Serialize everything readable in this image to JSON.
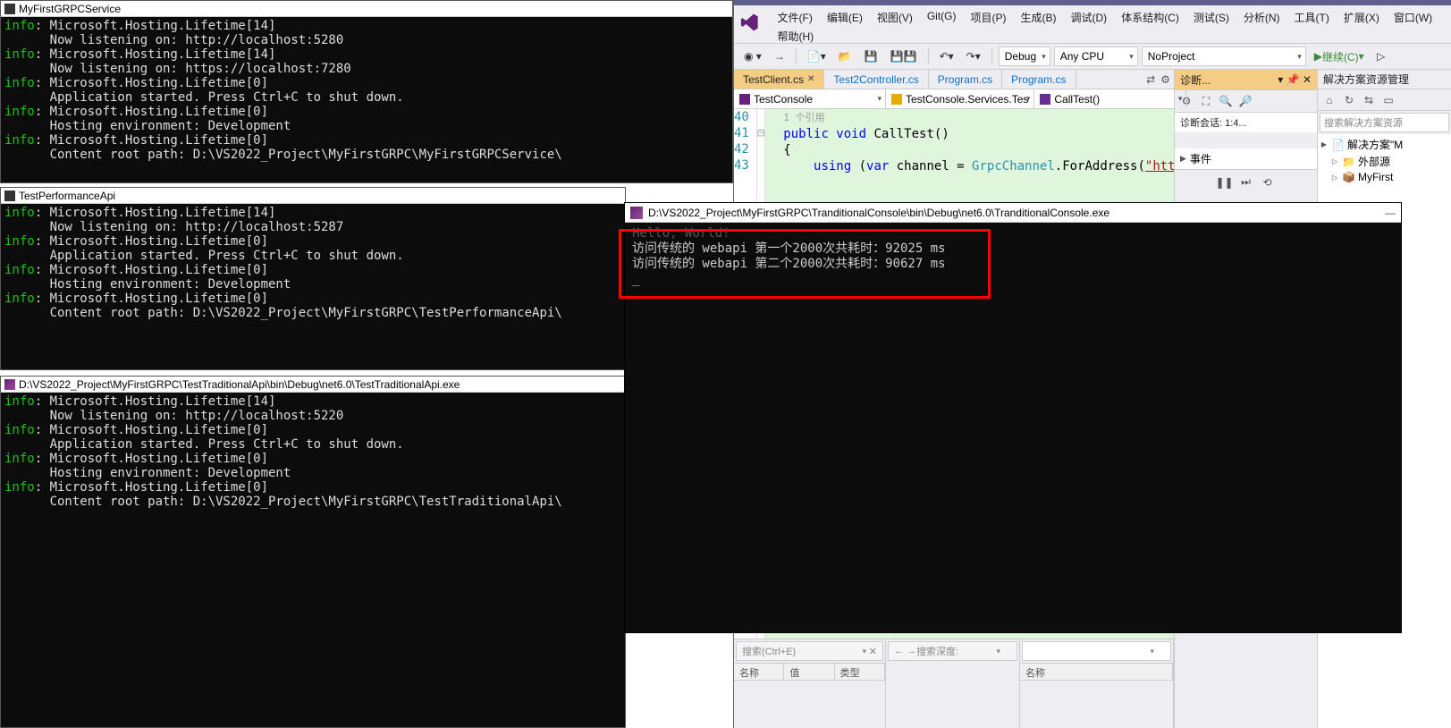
{
  "terminals": {
    "t1": {
      "title": "MyFirstGRPCService",
      "lines": [
        {
          "p": "info",
          "t": ": Microsoft.Hosting.Lifetime[14]"
        },
        {
          "p": "",
          "t": "      Now listening on: http://localhost:5280"
        },
        {
          "p": "info",
          "t": ": Microsoft.Hosting.Lifetime[14]"
        },
        {
          "p": "",
          "t": "      Now listening on: https://localhost:7280"
        },
        {
          "p": "info",
          "t": ": Microsoft.Hosting.Lifetime[0]"
        },
        {
          "p": "",
          "t": "      Application started. Press Ctrl+C to shut down."
        },
        {
          "p": "info",
          "t": ": Microsoft.Hosting.Lifetime[0]"
        },
        {
          "p": "",
          "t": "      Hosting environment: Development"
        },
        {
          "p": "info",
          "t": ": Microsoft.Hosting.Lifetime[0]"
        },
        {
          "p": "",
          "t": "      Content root path: D:\\VS2022_Project\\MyFirstGRPC\\MyFirstGRPCService\\"
        }
      ]
    },
    "t2": {
      "title": "TestPerformanceApi",
      "lines": [
        {
          "p": "info",
          "t": ": Microsoft.Hosting.Lifetime[14]"
        },
        {
          "p": "",
          "t": "      Now listening on: http://localhost:5287"
        },
        {
          "p": "info",
          "t": ": Microsoft.Hosting.Lifetime[0]"
        },
        {
          "p": "",
          "t": "      Application started. Press Ctrl+C to shut down."
        },
        {
          "p": "info",
          "t": ": Microsoft.Hosting.Lifetime[0]"
        },
        {
          "p": "",
          "t": "      Hosting environment: Development"
        },
        {
          "p": "info",
          "t": ": Microsoft.Hosting.Lifetime[0]"
        },
        {
          "p": "",
          "t": "      Content root path: D:\\VS2022_Project\\MyFirstGRPC\\TestPerformanceApi\\"
        }
      ]
    },
    "t3": {
      "title": "D:\\VS2022_Project\\MyFirstGRPC\\TestTraditionalApi\\bin\\Debug\\net6.0\\TestTraditionalApi.exe",
      "lines": [
        {
          "p": "info",
          "t": ": Microsoft.Hosting.Lifetime[14]"
        },
        {
          "p": "",
          "t": "      Now listening on: http://localhost:5220"
        },
        {
          "p": "info",
          "t": ": Microsoft.Hosting.Lifetime[0]"
        },
        {
          "p": "",
          "t": "      Application started. Press Ctrl+C to shut down."
        },
        {
          "p": "info",
          "t": ": Microsoft.Hosting.Lifetime[0]"
        },
        {
          "p": "",
          "t": "      Hosting environment: Development"
        },
        {
          "p": "info",
          "t": ": Microsoft.Hosting.Lifetime[0]"
        },
        {
          "p": "",
          "t": "      Content root path: D:\\VS2022_Project\\MyFirstGRPC\\TestTraditionalApi\\"
        }
      ]
    }
  },
  "overlay": {
    "title": "D:\\VS2022_Project\\MyFirstGRPC\\TranditionalConsole\\bin\\Debug\\net6.0\\TranditionalConsole.exe",
    "line0": "Hello, World!",
    "line1": "访问传统的 webapi 第一个2000次共耗时：92025 ms",
    "line2": "访问传统的 webapi 第二个2000次共耗时：90627 ms",
    "cursor": "_"
  },
  "vs": {
    "menu": [
      "文件(F)",
      "编辑(E)",
      "视图(V)",
      "Git(G)",
      "项目(P)",
      "生成(B)",
      "调试(D)",
      "体系结构(C)",
      "测试(S)",
      "分析(N)",
      "工具(T)",
      "扩展(X)",
      "窗口(W)",
      "帮助(H)"
    ],
    "toolbar": {
      "config": "Debug",
      "platform": "Any CPU",
      "project": "NoProject",
      "run": "继续(C)"
    },
    "tabs": {
      "active": "TestClient.cs",
      "others": [
        "Test2Controller.cs",
        "Program.cs",
        "Program.cs"
      ]
    },
    "crumbs": {
      "c1": "TestConsole",
      "c2": "TestConsole.Services.Tes",
      "c3": "CallTest()"
    },
    "code": {
      "ln40": "40",
      "ln41": "41",
      "ln42": "42",
      "ln43": "43",
      "refs": "1 个引用",
      "l41a": "public",
      "l41b": " void",
      "l41c": " CallTest()",
      "l42": "{",
      "l43a": "using",
      "l43b": " (",
      "l43c": "var",
      "l43d": " channel = ",
      "l43e": "GrpcChannel",
      "l43f": ".ForAddress(",
      "l43g": "\"https://localhos"
    },
    "diag": {
      "tab": "诊断...",
      "session": "诊断会话: 1:4...",
      "events": "事件"
    },
    "sol": {
      "title": "解决方案资源管理",
      "search": "搜索解决方案资源",
      "root": "解决方案\"M",
      "n1": "外部源",
      "n2": "MyFirst"
    },
    "bottom": {
      "search": "搜索(Ctrl+E)",
      "col_name": "名称",
      "col_value": "值",
      "col_type": "类型",
      "depth_lbl": "搜索深度:",
      "name2": "名称"
    }
  }
}
